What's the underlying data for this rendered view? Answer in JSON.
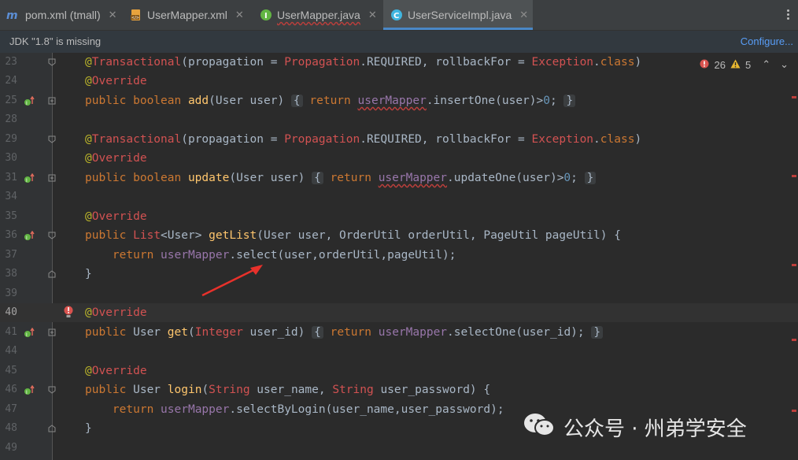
{
  "tabs": [
    {
      "label": "pom.xml (tmall)",
      "icon": "maven-icon"
    },
    {
      "label": "UserMapper.xml",
      "icon": "xml-file-icon"
    },
    {
      "label": "UserMapper.java",
      "icon": "interface-icon"
    },
    {
      "label": "UserServiceImpl.java",
      "icon": "class-icon"
    }
  ],
  "banner": {
    "message": "JDK \"1.8\" is missing",
    "action": "Configure..."
  },
  "status": {
    "errors": "26",
    "warnings": "5"
  },
  "lines": [
    {
      "n": "23",
      "t": "@Transactional(propagation = Propagation.REQUIRED, rollbackFor = Exception.class)"
    },
    {
      "n": "24",
      "t": "@Override"
    },
    {
      "n": "25",
      "t": "public boolean add(User user) { return userMapper.insertOne(user)>0; }"
    },
    {
      "n": "28",
      "t": ""
    },
    {
      "n": "29",
      "t": "@Transactional(propagation = Propagation.REQUIRED, rollbackFor = Exception.class)"
    },
    {
      "n": "30",
      "t": "@Override"
    },
    {
      "n": "31",
      "t": "public boolean update(User user) { return userMapper.updateOne(user)>0; }"
    },
    {
      "n": "34",
      "t": ""
    },
    {
      "n": "35",
      "t": "@Override"
    },
    {
      "n": "36",
      "t": "public List<User> getList(User user, OrderUtil orderUtil, PageUtil pageUtil) {"
    },
    {
      "n": "37",
      "t": "return userMapper.select(user,orderUtil,pageUtil);"
    },
    {
      "n": "38",
      "t": "}"
    },
    {
      "n": "39",
      "t": ""
    },
    {
      "n": "40",
      "t": "@Override"
    },
    {
      "n": "41",
      "t": "public User get(Integer user_id) { return userMapper.selectOne(user_id); }"
    },
    {
      "n": "44",
      "t": ""
    },
    {
      "n": "45",
      "t": "@Override"
    },
    {
      "n": "46",
      "t": "public User login(String user_name, String user_password) {"
    },
    {
      "n": "47",
      "t": "return userMapper.selectByLogin(user_name,user_password);"
    },
    {
      "n": "48",
      "t": "}"
    },
    {
      "n": "49",
      "t": ""
    }
  ],
  "watermark": "公众号 · 州弟学安全",
  "colors": {
    "keyword": "#cc7832",
    "annotation": "#bbb529",
    "field": "#9876aa",
    "method": "#ffc66d",
    "error": "#d25252",
    "arrow": "#e8312b"
  }
}
